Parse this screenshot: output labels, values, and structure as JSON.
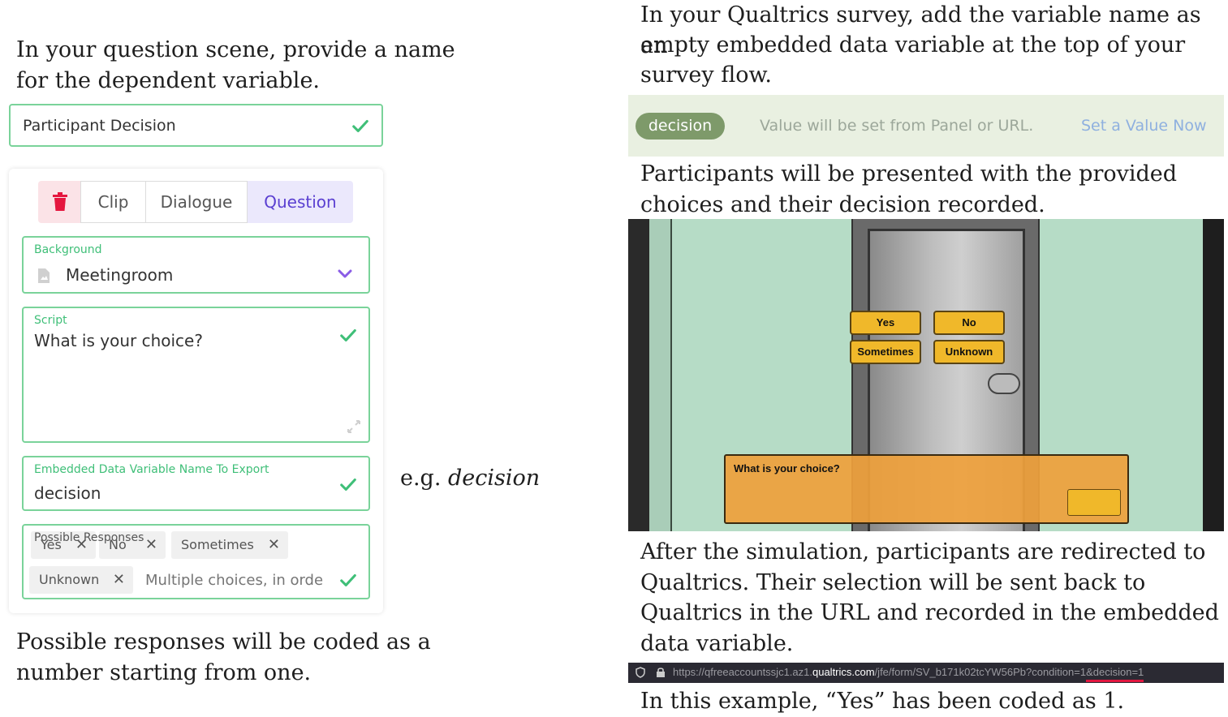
{
  "left": {
    "intro_text": "In your question scene, provide a name for the dependent variable.",
    "intro_line1": "In your question scene, provide a name",
    "intro_line2": "for the dependent variable.",
    "name_field_value": "Participant Decision",
    "tabs": [
      {
        "label": "Clip"
      },
      {
        "label": "Dialogue"
      },
      {
        "label": "Question",
        "active": true
      }
    ],
    "background": {
      "label": "Background",
      "value": "Meetingroom"
    },
    "script": {
      "label": "Script",
      "value": "What is your choice?"
    },
    "embedded": {
      "label": "Embedded Data Variable Name To Export",
      "value": "decision"
    },
    "example_prefix": "e.g. ",
    "example_value": "decision",
    "responses": {
      "label": "Possible Responses",
      "chips": [
        "Yes",
        "No",
        "Sometimes",
        "Unknown"
      ],
      "placeholder": "Multiple choices, in orde"
    },
    "footer_line1": "Possible responses will be coded as a",
    "footer_line2": "number starting from one."
  },
  "right": {
    "intro_line1": "In your Qualtrics survey, add the variable name as an",
    "intro_line2": "empty embedded data variable at the top of your",
    "intro_line3": "survey flow.",
    "embedded_bar": {
      "pill": "decision",
      "note": "Value will be set from Panel or URL.",
      "link": "Set a Value Now"
    },
    "present_line1": "Participants will be presented with the provided",
    "present_line2": "choices and their decision recorded.",
    "game": {
      "buttons": [
        "Yes",
        "No",
        "Sometimes",
        "Unknown"
      ],
      "question": "What is your choice?"
    },
    "after_line1": "After the simulation, participants are redirected to",
    "after_line2": "Qualtrics. Their selection will be sent back to",
    "after_line3": "Qualtrics in the URL and recorded in the embedded",
    "after_line4": "data variable.",
    "url": {
      "prefix": "https://qfreeaccountssjc1.az1.",
      "domain": "qualtrics.com",
      "path": "/jfe/form/SV_b171k02tcYW56Pb?condition=1",
      "param": "&decision=1"
    },
    "example_text": "In this example, “Yes” has been coded as 1."
  },
  "colors": {
    "green_border": "#7ad39a",
    "accent_purple": "#5a3fd1",
    "delete_red": "#e5173f",
    "game_button": "#f0b82a",
    "game_panel": "#eaa044",
    "scene_bg": "#b6dcc6"
  }
}
